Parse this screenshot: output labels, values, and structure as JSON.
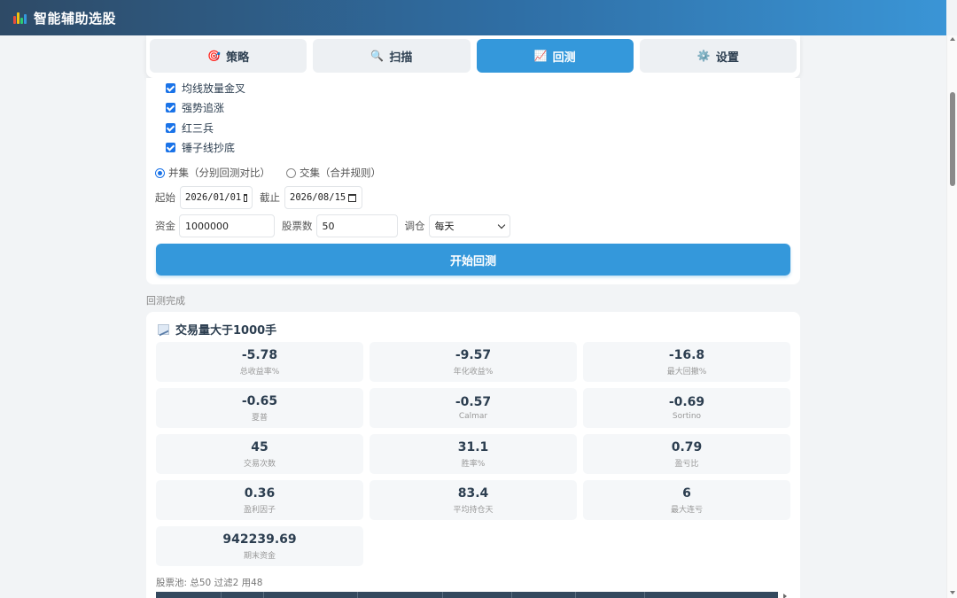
{
  "header": {
    "title": "智能辅助选股"
  },
  "tabs": [
    {
      "icon": "🎯",
      "label": "策略",
      "active": false
    },
    {
      "icon": "🔍",
      "label": "扫描",
      "active": false
    },
    {
      "icon": "📈",
      "label": "回测",
      "active": true
    },
    {
      "icon": "⚙️",
      "label": "设置",
      "active": false
    }
  ],
  "strategies": [
    {
      "label": "均线放量金叉",
      "checked": true
    },
    {
      "label": "强势追涨",
      "checked": true
    },
    {
      "label": "红三兵",
      "checked": true
    },
    {
      "label": "锤子线抄底",
      "checked": true
    }
  ],
  "mode": {
    "union_label": "并集（分别回测对比）",
    "intersect_label": "交集（合并规则）",
    "selected": "union"
  },
  "dates": {
    "start_label": "起始",
    "start_value": "2026/01/01",
    "end_label": "截止",
    "end_value": "2026/08/15"
  },
  "params": {
    "capital_label": "资金",
    "capital_value": "1000000",
    "stocks_label": "股票数",
    "stocks_value": "50",
    "rebalance_label": "调仓",
    "rebalance_value": "每天"
  },
  "start_button": "开始回测",
  "status_text": "回测完成",
  "result": {
    "title": "交易量大于1000手",
    "stats": [
      {
        "value": "-5.78",
        "label": "总收益率%"
      },
      {
        "value": "-9.57",
        "label": "年化收益%"
      },
      {
        "value": "-16.8",
        "label": "最大回撤%"
      },
      {
        "value": "-0.65",
        "label": "夏普"
      },
      {
        "value": "-0.57",
        "label": "Calmar"
      },
      {
        "value": "-0.69",
        "label": "Sortino"
      },
      {
        "value": "45",
        "label": "交易次数"
      },
      {
        "value": "31.1",
        "label": "胜率%"
      },
      {
        "value": "0.79",
        "label": "盈亏比"
      },
      {
        "value": "0.36",
        "label": "盈利因子"
      },
      {
        "value": "83.4",
        "label": "平均持仓天"
      },
      {
        "value": "6",
        "label": "最大连亏"
      },
      {
        "value": "942239.69",
        "label": "期末资金"
      }
    ],
    "pool_text": "股票池: 总50 过滤2 用48"
  },
  "colors": {
    "accent": "#3498db",
    "header_start": "#2e4a66",
    "header_end": "#3a95d6",
    "table_head": "#34495e"
  }
}
